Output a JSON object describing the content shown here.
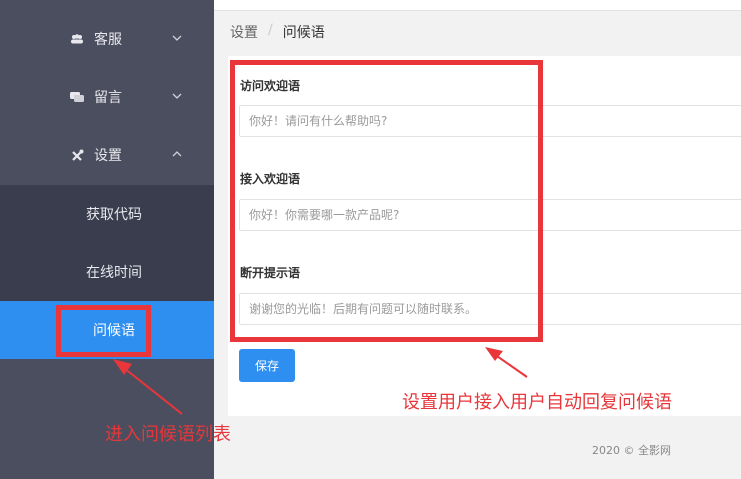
{
  "sidebar": {
    "items": [
      {
        "label": "客服",
        "icon": "users-icon"
      },
      {
        "label": "留言",
        "icon": "comments-icon"
      },
      {
        "label": "设置",
        "icon": "tools-icon"
      }
    ],
    "submenu": [
      {
        "label": "获取代码"
      },
      {
        "label": "在线时间"
      },
      {
        "label": "问候语",
        "active": true
      }
    ]
  },
  "breadcrumb": {
    "root": "设置",
    "separator": "/",
    "current": "问候语"
  },
  "form": {
    "fields": [
      {
        "label": "访问欢迎语",
        "placeholder": "你好！请问有什么帮助吗?"
      },
      {
        "label": "接入欢迎语",
        "placeholder": "你好！你需要哪一款产品呢?"
      },
      {
        "label": "断开提示语",
        "placeholder": "谢谢您的光临！后期有问题可以随时联系。"
      }
    ],
    "save_label": "保存"
  },
  "footer": "2020 © 全影网",
  "annotations": {
    "right_note": "设置用户接入用户自动回复问候语",
    "left_note": "进入问候语列表"
  },
  "colors": {
    "sidebar_bg": "#4b4e5e",
    "submenu_bg": "#393d4d",
    "accent": "#2f8ff0",
    "annotation": "#e8363a"
  }
}
